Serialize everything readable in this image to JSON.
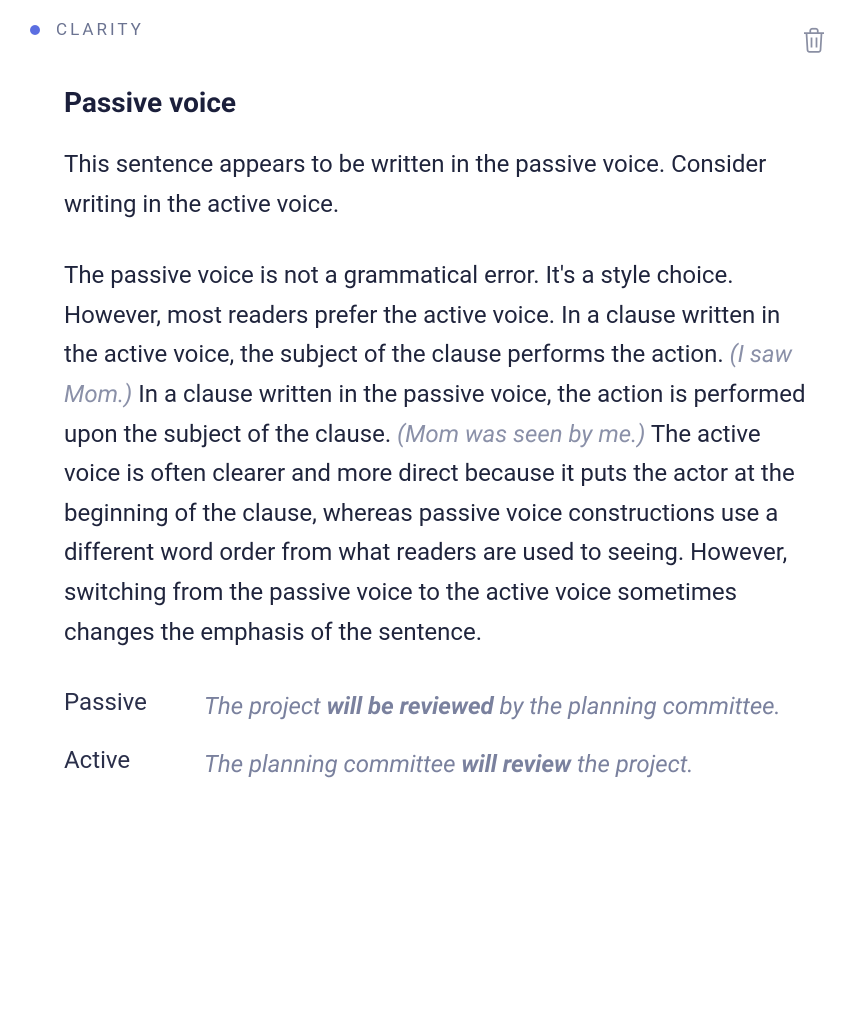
{
  "category": "CLARITY",
  "title": "Passive voice",
  "summary": "This sentence appears to be written in the passive voice. Consider writing in the active voice.",
  "explanation": {
    "part1": "The passive voice is not a grammatical error. It's a style choice. However, most readers prefer the active voice. In a clause written in the active voice, the subject of the clause performs the action. ",
    "inline1": "(I saw Mom.)",
    "part2": " In a clause written in the passive voice, the action is performed upon the subject of the clause. ",
    "inline2": "(Mom was seen by me.)",
    "part3": " The active voice is often clearer and more direct because it puts the actor at the beginning of the clause, whereas passive voice constructions use a different word order from what readers are used to seeing. However, switching from the passive voice to the active voice sometimes changes the emphasis of the sentence."
  },
  "examples": {
    "passive": {
      "label": "Passive",
      "pre": "The project ",
      "bold": "will be reviewed",
      "post": " by the planning committee."
    },
    "active": {
      "label": "Active",
      "pre": "The planning committee ",
      "bold": "will review",
      "post": " the project."
    }
  }
}
